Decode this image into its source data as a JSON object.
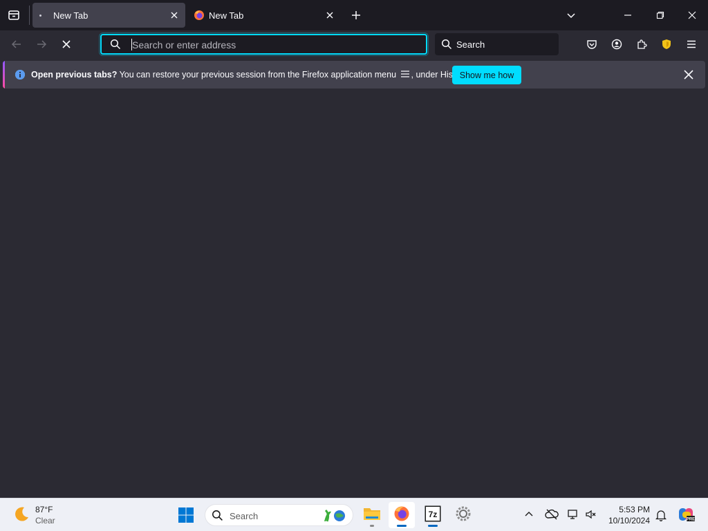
{
  "tabs": [
    {
      "title": "New Tab",
      "active": true
    },
    {
      "title": "New Tab",
      "active": false
    }
  ],
  "urlbar": {
    "placeholder": "Search or enter address"
  },
  "searchbar": {
    "label": "Search"
  },
  "notification": {
    "bold": "Open previous tabs?",
    "text": " You can restore your previous session from the Firefox application menu ",
    "tail": ", under History.",
    "button": "Show me how"
  },
  "taskbar": {
    "weather": {
      "temp": "87°F",
      "desc": "Clear"
    },
    "search_label": "Search",
    "apps": [
      "file-explorer",
      "firefox",
      "7-zip",
      "settings"
    ],
    "clock": {
      "time": "5:53 PM",
      "date": "10/10/2024"
    }
  },
  "colors": {
    "accent": "#00ddff",
    "chrome": "#1c1b22",
    "toolbar": "#2b2a33",
    "tab": "#42414d"
  }
}
